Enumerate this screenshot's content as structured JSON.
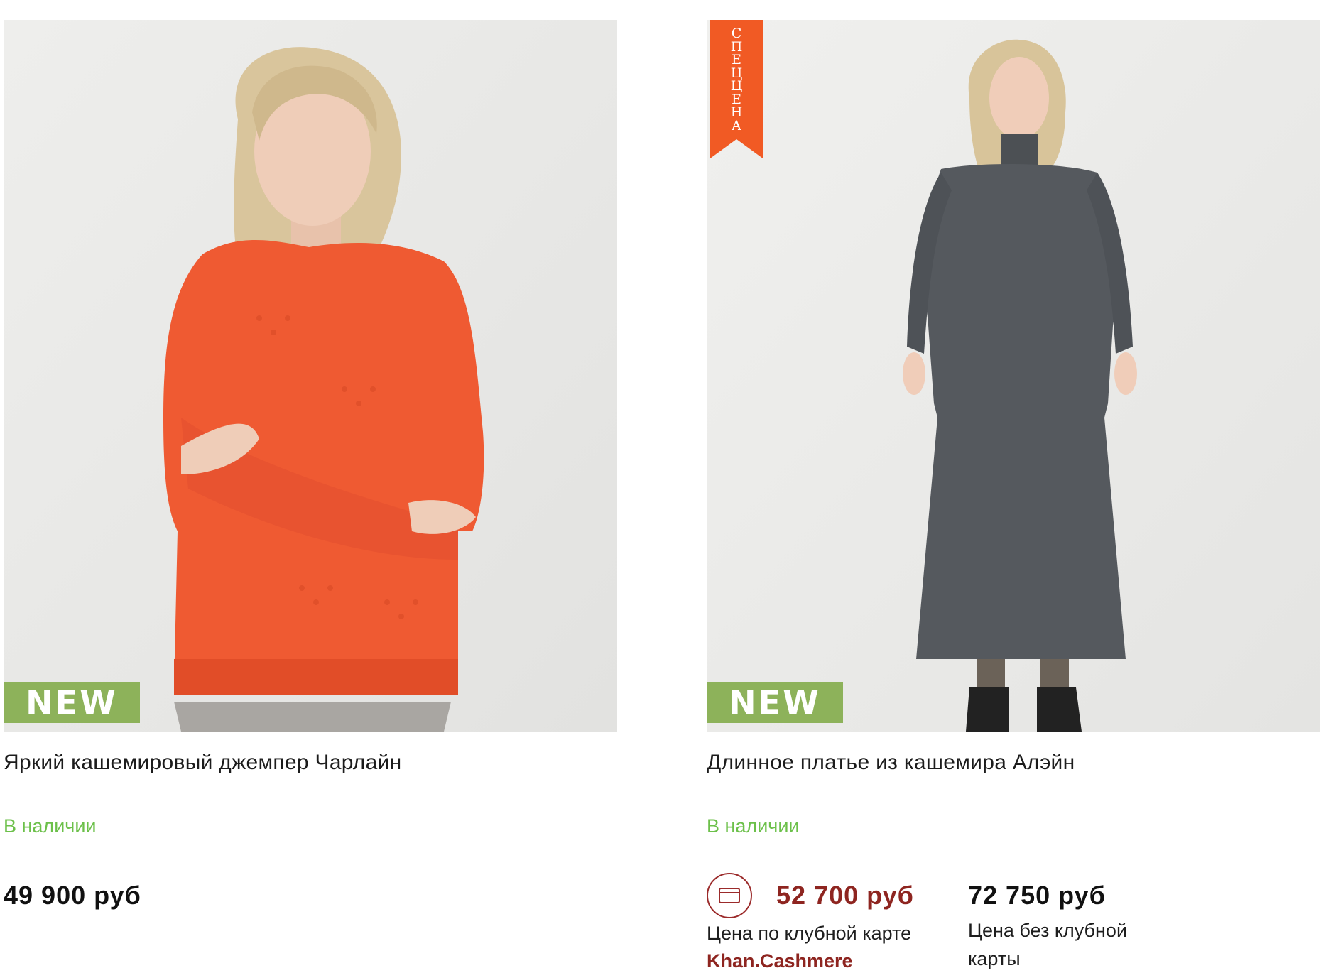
{
  "products": [
    {
      "badge": "NEW",
      "title": "Яркий кашемировый джемпер Чарлайн",
      "availability": "В наличии",
      "price": "49 900 руб",
      "image_alt": "Woman in orange cashmere sweater"
    },
    {
      "badge": "NEW",
      "ribbon": "СПЕЦЦЕНА",
      "title": "Длинное платье из кашемира Алэйн",
      "availability": "В наличии",
      "club_price": "52 700  руб",
      "club_caption": "Цена по клубной карте",
      "club_brand": "Khan.Cashmere",
      "regular_price": "72 750 руб",
      "regular_caption_line1": "Цена без клубной",
      "regular_caption_line2": "карты",
      "image_alt": "Woman in long grey cashmere dress"
    }
  ],
  "colors": {
    "new_badge": "#8db25a",
    "ribbon": "#f15a24",
    "in_stock": "#6cc04a",
    "club_accent": "#8e2520"
  },
  "icons": {
    "club_card": "credit-card-icon"
  }
}
